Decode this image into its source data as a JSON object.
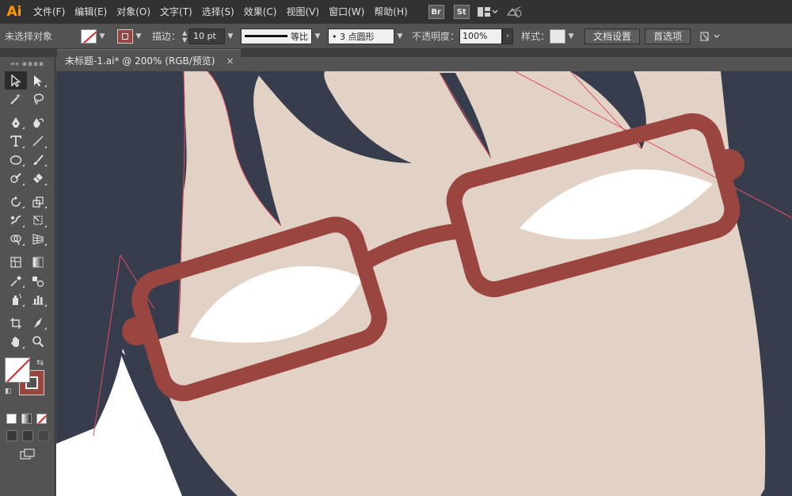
{
  "app": {
    "logo": "Ai"
  },
  "menu": [
    "文件(F)",
    "编辑(E)",
    "对象(O)",
    "文字(T)",
    "选择(S)",
    "效果(C)",
    "视图(V)",
    "窗口(W)",
    "帮助(H)"
  ],
  "bridge": {
    "br": "Br",
    "st": "St"
  },
  "control_bar": {
    "selection_label": "未选择对象",
    "stroke_label": "描边：",
    "stroke_value": "10 pt",
    "profile_label": "等比",
    "brush_label": "•  3 点圆形",
    "opacity_label": "不透明度：",
    "opacity_value": "100%",
    "style_label": "样式：",
    "doc_setup_button": "文档设置",
    "preferences_button": "首选项"
  },
  "document_tab": {
    "title": "未标题-1.ai* @ 200% (RGB/预览)",
    "close": "×"
  },
  "colors": {
    "canvas_bg": "#383d4d",
    "skin": "#e2d1c5",
    "frame": "#9a4540",
    "lens_white": "#ffffff",
    "guide_line": "#e05060",
    "app_accent": "#ff9a00"
  },
  "icons": {
    "selection": "selection-arrow-icon",
    "direct_selection": "direct-selection-icon",
    "magic_wand": "magic-wand-icon",
    "lasso": "lasso-icon",
    "pen": "pen-icon",
    "curvature": "curvature-pen-icon",
    "type": "type-icon",
    "line": "line-segment-icon",
    "ellipse": "ellipse-icon",
    "paintbrush": "paintbrush-icon",
    "shaper": "shaper-icon",
    "eraser": "eraser-icon",
    "rotate": "rotate-icon",
    "scale": "scale-icon",
    "warp": "warp-icon",
    "free_transform": "free-transform-icon",
    "shape_builder": "shape-builder-icon",
    "perspective": "perspective-grid-icon",
    "mesh": "mesh-icon",
    "gradient": "gradient-icon",
    "eyedropper": "eyedropper-icon",
    "blend": "blend-icon",
    "symbol_sprayer": "symbol-sprayer-icon",
    "column_graph": "column-graph-icon",
    "artboard": "artboard-icon",
    "slice": "slice-icon",
    "hand": "hand-icon",
    "zoom": "zoom-icon"
  }
}
